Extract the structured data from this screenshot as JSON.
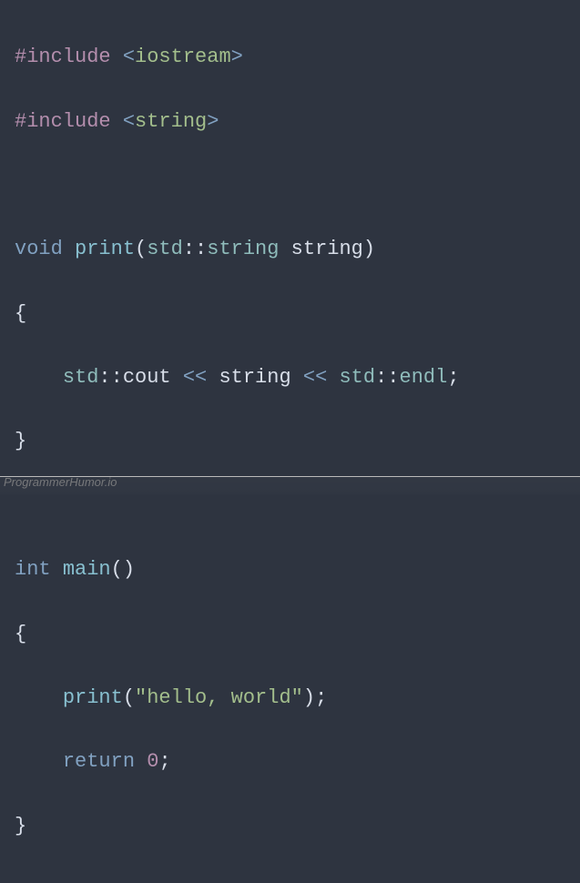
{
  "code": {
    "line1": {
      "include": "#include",
      "open": "<",
      "target": "iostream",
      "close": ">"
    },
    "line2": {
      "include": "#include",
      "open": "<",
      "target": "string",
      "close": ">"
    },
    "line4": {
      "ret_type": "void",
      "func": "print",
      "lparen": "(",
      "ns": "std",
      "scope": "::",
      "type": "string",
      "param": "string",
      "rparen": ")"
    },
    "line5": {
      "brace": "{"
    },
    "line6": {
      "indent": "    ",
      "ns1": "std",
      "scope1": "::",
      "cout": "cout",
      "op1": " << ",
      "var": "string",
      "op2": " << ",
      "ns2": "std",
      "scope2": "::",
      "endl": "endl",
      "semi": ";"
    },
    "line7": {
      "brace": "}"
    },
    "line9": {
      "ret_type": "int",
      "func": "main",
      "lparen": "(",
      "rparen": ")"
    },
    "line10": {
      "brace": "{"
    },
    "line11": {
      "indent": "    ",
      "func": "print",
      "lparen": "(",
      "str": "\"hello, world\"",
      "rparen": ")",
      "semi": ";"
    },
    "line12": {
      "indent": "    ",
      "keyword": "return",
      "space": " ",
      "num": "0",
      "semi": ";"
    },
    "line13": {
      "brace": "}"
    }
  },
  "watermark": "ProgrammerHumor.io"
}
